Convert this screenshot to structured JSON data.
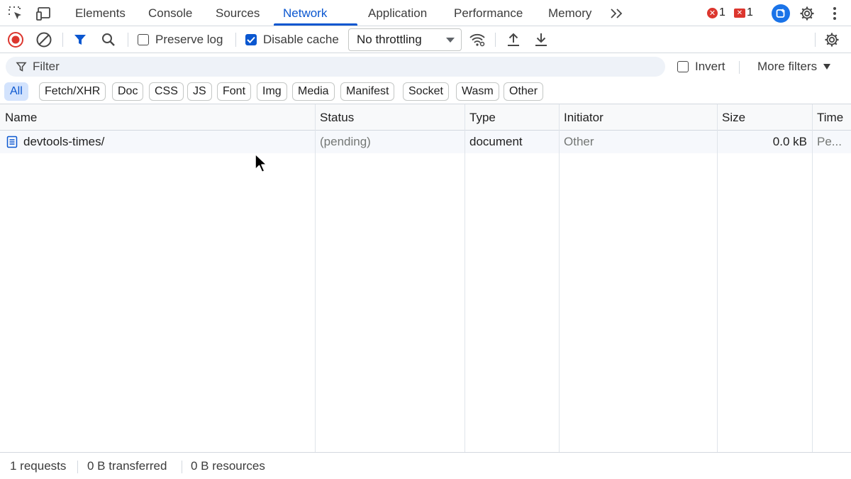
{
  "tabbar": {
    "tabs": [
      {
        "label": "Elements"
      },
      {
        "label": "Console"
      },
      {
        "label": "Sources"
      },
      {
        "label": "Network"
      },
      {
        "label": "Application"
      },
      {
        "label": "Performance"
      },
      {
        "label": "Memory"
      }
    ],
    "active_tab": "Network",
    "error_count": "1",
    "issue_count": "1"
  },
  "toolbar": {
    "preserve_log_label": "Preserve log",
    "preserve_log_checked": false,
    "disable_cache_label": "Disable cache",
    "disable_cache_checked": true,
    "throttling_value": "No throttling"
  },
  "filter": {
    "placeholder": "Filter",
    "invert_label": "Invert",
    "invert_checked": false,
    "more_filters_label": "More filters"
  },
  "type_filters": [
    "All",
    "Fetch/XHR",
    "Doc",
    "CSS",
    "JS",
    "Font",
    "Img",
    "Media",
    "Manifest",
    "Socket",
    "Wasm",
    "Other"
  ],
  "active_type_filter": "All",
  "table": {
    "columns": [
      "Name",
      "Status",
      "Type",
      "Initiator",
      "Size",
      "Time"
    ],
    "rows": [
      {
        "name": "devtools-times/",
        "status": "(pending)",
        "type": "document",
        "initiator": "Other",
        "size": "0.0 kB",
        "time": "Pe..."
      }
    ]
  },
  "statusbar": {
    "requests": "1 requests",
    "transferred": "0 B transferred",
    "resources": "0 B resources"
  },
  "colors": {
    "accent": "#0b57d0",
    "record_red": "#dc362e",
    "chip_active_bg": "#d3e3fd"
  },
  "icons": [
    "inspect-element-icon",
    "device-toolbar-icon",
    "more-tabs-icon",
    "error-icon",
    "issue-icon",
    "ai-assistant-icon",
    "settings-icon",
    "kebab-menu-icon",
    "record-icon",
    "clear-icon",
    "filter-icon",
    "search-icon",
    "network-conditions-icon",
    "import-har-icon",
    "export-har-icon",
    "network-settings-icon",
    "document-icon"
  ]
}
